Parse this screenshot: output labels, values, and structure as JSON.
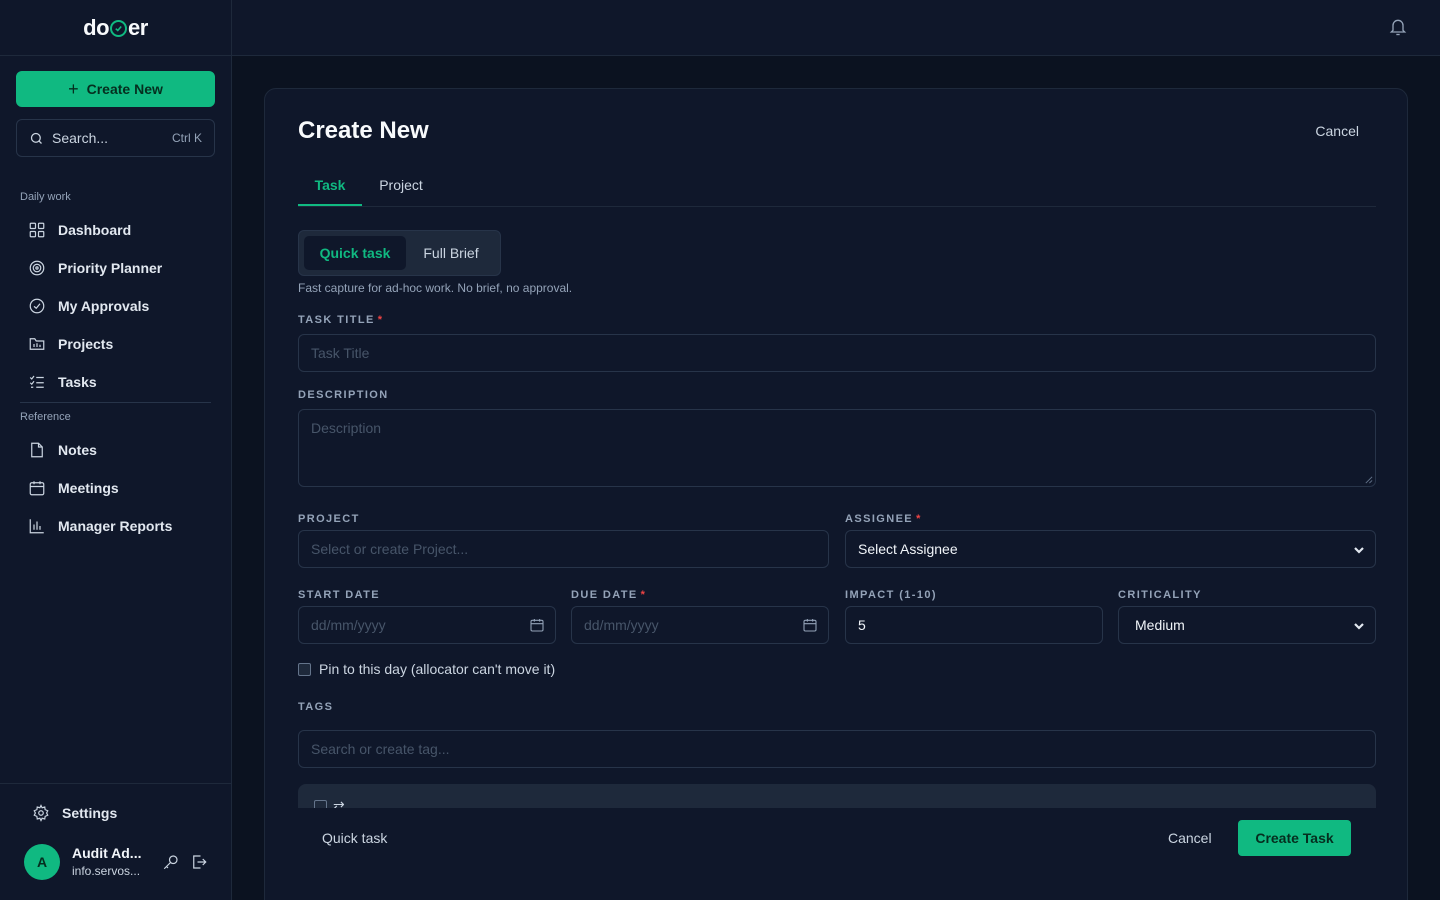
{
  "app": {
    "logo_prefix": "do",
    "logo_suffix": "er"
  },
  "sidebar": {
    "create_label": "Create New",
    "search_label": "Search...",
    "search_shortcut": "Ctrl K",
    "section_daily": "Daily work",
    "section_reference": "Reference",
    "items": [
      {
        "label": "Dashboard",
        "icon": "grid-icon"
      },
      {
        "label": "Priority Planner",
        "icon": "target-icon"
      },
      {
        "label": "My Approvals",
        "icon": "check-circle-icon"
      },
      {
        "label": "Projects",
        "icon": "folder-chart-icon"
      },
      {
        "label": "Tasks",
        "icon": "list-check-icon"
      },
      {
        "label": "Notes",
        "icon": "file-icon"
      },
      {
        "label": "Meetings",
        "icon": "calendar-icon"
      },
      {
        "label": "Manager Reports",
        "icon": "bar-chart-icon"
      }
    ],
    "settings_label": "Settings",
    "user": {
      "initial": "A",
      "name": "Audit Ad...",
      "email": "info.servos..."
    }
  },
  "modal": {
    "title": "Create New",
    "cancel_top": "Cancel",
    "tabs": [
      "Task",
      "Project"
    ],
    "modes": [
      "Quick task",
      "Full Brief"
    ],
    "helper": "Fast capture for ad-hoc work. No brief, no approval.",
    "fields": {
      "task_title_label": "TASK TITLE",
      "task_title_placeholder": "Task Title",
      "description_label": "DESCRIPTION",
      "description_placeholder": "Description",
      "project_label": "PROJECT",
      "project_placeholder": "Select or create Project...",
      "assignee_label": "ASSIGNEE",
      "assignee_value": "Select Assignee",
      "start_date_label": "START DATE",
      "start_date_placeholder": "dd/mm/yyyy",
      "due_date_label": "DUE DATE",
      "due_date_placeholder": "dd/mm/yyyy",
      "impact_label": "IMPACT (1-10)",
      "impact_value": "5",
      "criticality_label": "CRITICALITY",
      "criticality_value": "Medium",
      "pin_label": "Pin to this day (allocator can't move it)",
      "tags_label": "TAGS",
      "tags_placeholder": "Search or create tag...",
      "required_mark": "*"
    },
    "footer": {
      "mode_label": "Quick task",
      "cancel_label": "Cancel",
      "submit_label": "Create Task"
    }
  },
  "colors": {
    "accent": "#10b981",
    "background": "#0b1220",
    "panel": "#0f172a",
    "required": "#ef4444"
  }
}
